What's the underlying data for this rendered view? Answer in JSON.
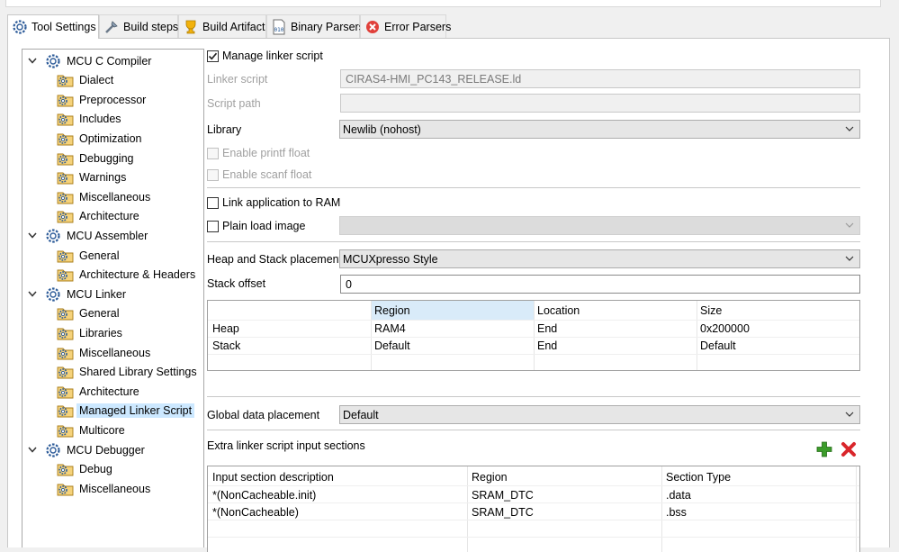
{
  "tabs": [
    {
      "label": "Tool Settings",
      "icon": "tool-settings-icon",
      "active": true
    },
    {
      "label": "Build steps",
      "icon": "build-steps-icon"
    },
    {
      "label": "Build Artifact",
      "icon": "build-artifact-icon"
    },
    {
      "label": "Binary Parsers",
      "icon": "binary-parsers-icon"
    },
    {
      "label": "Error Parsers",
      "icon": "error-parsers-icon"
    }
  ],
  "tree": {
    "mcu_c_compiler": {
      "label": "MCU C Compiler",
      "children": [
        "Dialect",
        "Preprocessor",
        "Includes",
        "Optimization",
        "Debugging",
        "Warnings",
        "Miscellaneous",
        "Architecture"
      ]
    },
    "mcu_assembler": {
      "label": "MCU Assembler",
      "children": [
        "General",
        "Architecture & Headers"
      ]
    },
    "mcu_linker": {
      "label": "MCU Linker",
      "children": [
        "General",
        "Libraries",
        "Miscellaneous",
        "Shared Library Settings",
        "Architecture",
        "Managed Linker Script",
        "Multicore"
      ]
    },
    "mcu_debugger": {
      "label": "MCU Debugger",
      "children": [
        "Debug",
        "Miscellaneous"
      ]
    },
    "selected": "Managed Linker Script"
  },
  "form": {
    "manage_linker_script": {
      "label": "Manage linker script",
      "checked": true
    },
    "linker_script": {
      "label": "Linker script",
      "value": "CIRAS4-HMI_PC143_RELEASE.ld"
    },
    "script_path": {
      "label": "Script path",
      "value": ""
    },
    "library": {
      "label": "Library",
      "value": "Newlib (nohost)"
    },
    "enable_printf_float": {
      "label": "Enable printf float",
      "checked": false
    },
    "enable_scanf_float": {
      "label": "Enable scanf float",
      "checked": false
    },
    "link_to_ram": {
      "label": "Link application to RAM",
      "checked": false
    },
    "plain_load_image": {
      "label": "Plain load image",
      "checked": false,
      "value": ""
    },
    "heap_stack_placement": {
      "label": "Heap and Stack placement",
      "value": "MCUXpresso Style"
    },
    "stack_offset": {
      "label": "Stack offset",
      "value": "0"
    },
    "heap_stack_table": {
      "headers": [
        "",
        "Region",
        "Location",
        "Size"
      ],
      "rows": [
        [
          "Heap",
          "RAM4",
          "End",
          "0x200000"
        ],
        [
          "Stack",
          "Default",
          "End",
          "Default"
        ]
      ]
    },
    "global_data_placement": {
      "label": "Global data placement",
      "value": "Default"
    },
    "extra_sections": {
      "label": "Extra linker script input sections",
      "headers": [
        "Input section description",
        "Region",
        "Section Type"
      ],
      "rows": [
        [
          "*(NonCacheable.init)",
          "SRAM_DTC",
          ".data"
        ],
        [
          "*(NonCacheable)",
          "SRAM_DTC",
          ".bss"
        ]
      ]
    }
  },
  "colors": {
    "selection": "#cce8ff",
    "header_selected": "#d9ebf9",
    "add_green": "#3c9c2b",
    "remove_red": "#d9262b"
  }
}
